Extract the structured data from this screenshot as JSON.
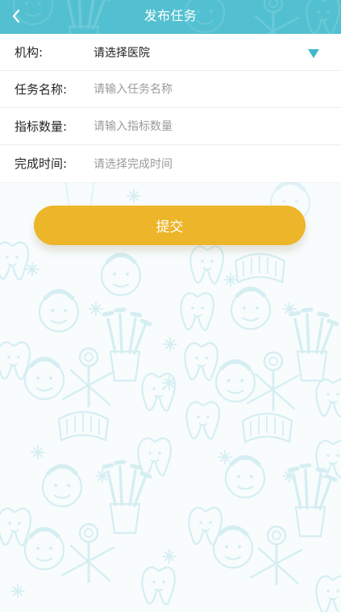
{
  "header": {
    "title": "发布任务",
    "back_icon": "chevron-left-icon",
    "background_color": "#52c0d0"
  },
  "form": {
    "institution": {
      "label": "机构:",
      "value": "请选择医院",
      "dropdown_icon": "triangle-down-icon",
      "accent_color": "#3db9cb"
    },
    "task_name": {
      "label": "任务名称:",
      "placeholder": "请输入任务名称"
    },
    "target_quantity": {
      "label": "指标数量:",
      "placeholder": "请输入指标数量"
    },
    "completion_time": {
      "label": "完成时间:",
      "value": "请选择完成时间"
    }
  },
  "actions": {
    "submit_label": "提交",
    "submit_color": "#edb529"
  },
  "background": {
    "pattern_icons": [
      "tooth-icon",
      "toothbrush-icon",
      "dental-mirror-icon",
      "sparkle-icon",
      "patient-face-icon"
    ],
    "pattern_color": "#d7eff3"
  }
}
